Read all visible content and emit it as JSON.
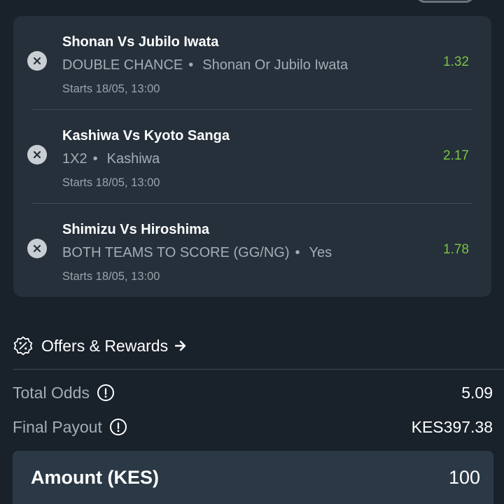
{
  "bets": [
    {
      "match": "Shonan Vs Jubilo Iwata",
      "market": "DOUBLE CHANCE",
      "selection": "Shonan Or Jubilo Iwata",
      "starts": "Starts 18/05, 13:00",
      "odds": "1.32"
    },
    {
      "match": "Kashiwa Vs Kyoto Sanga",
      "market": "1X2",
      "selection": "Kashiwa",
      "starts": "Starts 18/05, 13:00",
      "odds": "2.17"
    },
    {
      "match": "Shimizu Vs Hiroshima",
      "market": "BOTH TEAMS TO SCORE (GG/NG)",
      "selection": "Yes",
      "starts": "Starts 18/05, 13:00",
      "odds": "1.78"
    }
  ],
  "separator": "•",
  "offers": {
    "label": "Offers & Rewards",
    "icon": "percent-badge-icon",
    "arrow_icon": "arrow-right-icon"
  },
  "summary": {
    "total_odds_label": "Total Odds",
    "total_odds_value": "5.09",
    "final_payout_label": "Final Payout",
    "final_payout_value": "KES397.38",
    "info_icon": "info-icon"
  },
  "amount": {
    "label": "Amount (KES)",
    "value": "100"
  },
  "colors": {
    "background": "#19212b",
    "card": "#25303b",
    "odds_green": "#7cc242",
    "muted_text": "#a4adb6",
    "amount_box": "#2b3946"
  }
}
